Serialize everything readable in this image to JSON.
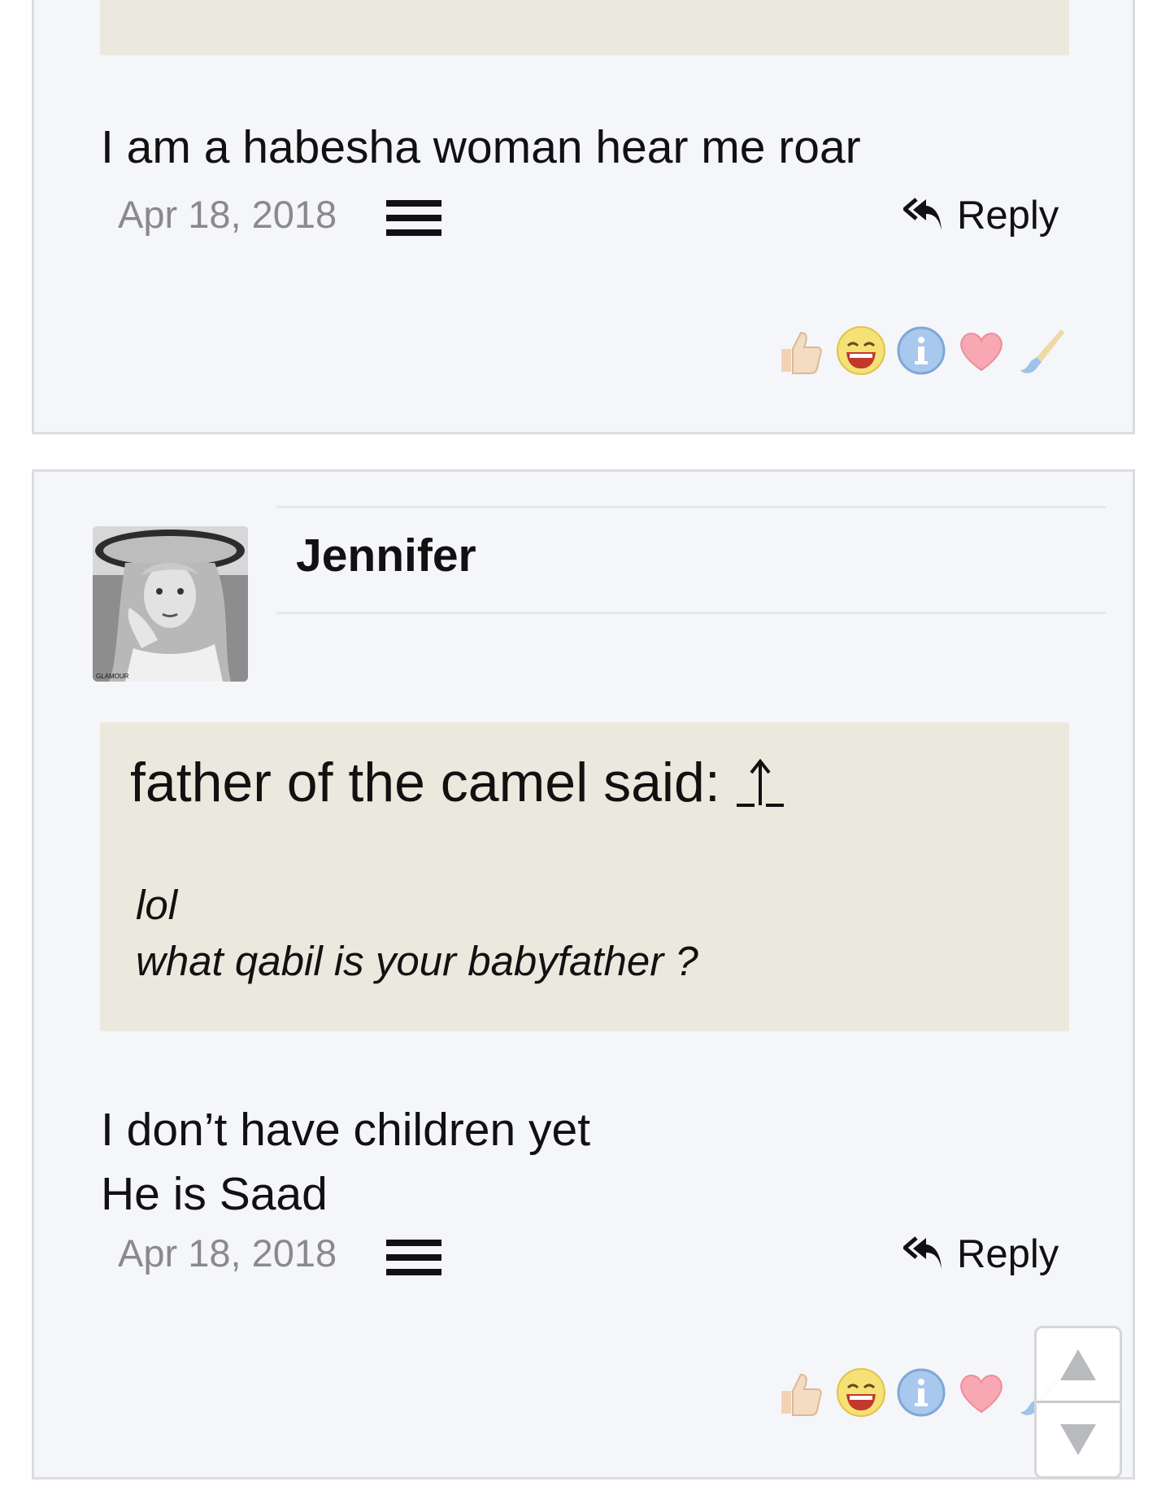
{
  "posts": [
    {
      "message": "I am a habesha woman hear me roar",
      "date": "Apr 18, 2018",
      "reply_label": "Reply"
    },
    {
      "author": "Jennifer",
      "quote": {
        "header": "father of the camel said:",
        "body": "lol\nwhat qabil is your babyfather ?"
      },
      "message": "I don’t have children yet\nHe is Saad",
      "date": "Apr 18, 2018",
      "reply_label": "Reply"
    }
  ],
  "reactions": [
    "thumbs-up-icon",
    "laugh-icon",
    "info-icon",
    "heart-icon",
    "brush-icon"
  ],
  "avatar_caption": "GLAMOUR",
  "colors": {
    "post_background": "#f5f6fa",
    "quote_background": "#ebe9dd",
    "border": "#dcdde1",
    "date_text": "#8a8a8a"
  }
}
